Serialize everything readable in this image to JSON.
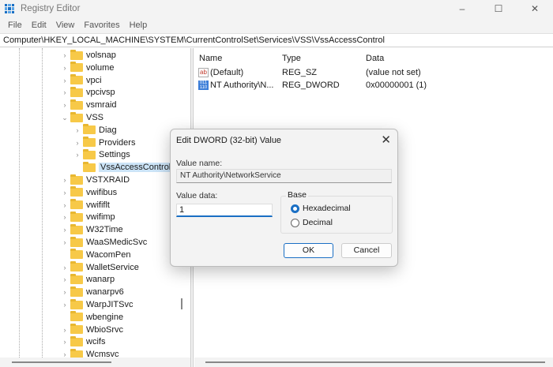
{
  "window": {
    "title": "Registry Editor",
    "minimize": "–",
    "maximize": "☐",
    "close": "✕"
  },
  "menu": [
    "File",
    "Edit",
    "View",
    "Favorites",
    "Help"
  ],
  "address": "Computer\\HKEY_LOCAL_MACHINE\\SYSTEM\\CurrentControlSet\\Services\\VSS\\VssAccessControl",
  "tree": [
    {
      "label": "volsnap",
      "level": 0,
      "exp": "›"
    },
    {
      "label": "volume",
      "level": 0,
      "exp": "›"
    },
    {
      "label": "vpci",
      "level": 0,
      "exp": "›"
    },
    {
      "label": "vpcivsp",
      "level": 0,
      "exp": "›"
    },
    {
      "label": "vsmraid",
      "level": 0,
      "exp": "›"
    },
    {
      "label": "VSS",
      "level": 0,
      "exp": "⌄"
    },
    {
      "label": "Diag",
      "level": 1,
      "exp": "›"
    },
    {
      "label": "Providers",
      "level": 1,
      "exp": "›"
    },
    {
      "label": "Settings",
      "level": 1,
      "exp": "›"
    },
    {
      "label": "VssAccessControl",
      "level": 1,
      "exp": "",
      "selected": true
    },
    {
      "label": "VSTXRAID",
      "level": 0,
      "exp": "›"
    },
    {
      "label": "vwifibus",
      "level": 0,
      "exp": "›"
    },
    {
      "label": "vwififlt",
      "level": 0,
      "exp": "›"
    },
    {
      "label": "vwifimp",
      "level": 0,
      "exp": "›"
    },
    {
      "label": "W32Time",
      "level": 0,
      "exp": "›"
    },
    {
      "label": "WaaSMedicSvc",
      "level": 0,
      "exp": "›"
    },
    {
      "label": "WacomPen",
      "level": 0,
      "exp": ""
    },
    {
      "label": "WalletService",
      "level": 0,
      "exp": "›"
    },
    {
      "label": "wanarp",
      "level": 0,
      "exp": "›"
    },
    {
      "label": "wanarpv6",
      "level": 0,
      "exp": "›"
    },
    {
      "label": "WarpJITSvc",
      "level": 0,
      "exp": "›"
    },
    {
      "label": "wbengine",
      "level": 0,
      "exp": ""
    },
    {
      "label": "WbioSrvc",
      "level": 0,
      "exp": "›"
    },
    {
      "label": "wcifs",
      "level": 0,
      "exp": "›"
    },
    {
      "label": "Wcmsvc",
      "level": 0,
      "exp": "›"
    }
  ],
  "list": {
    "headers": {
      "name": "Name",
      "type": "Type",
      "data": "Data"
    },
    "rows": [
      {
        "icon": "ab",
        "name": "(Default)",
        "type": "REG_SZ",
        "data": "(value not set)"
      },
      {
        "icon": "bin",
        "name": "NT Authority\\N...",
        "type": "REG_DWORD",
        "data": "0x00000001 (1)"
      }
    ]
  },
  "dialog": {
    "title": "Edit DWORD (32-bit) Value",
    "close": "✕",
    "value_name_label": "Value name:",
    "value_name": "NT Authority\\NetworkService",
    "value_data_label": "Value data:",
    "value_data": "1",
    "base_label": "Base",
    "hex_label": "Hexadecimal",
    "dec_label": "Decimal",
    "selected_base": "Hexadecimal",
    "ok": "OK",
    "cancel": "Cancel"
  }
}
